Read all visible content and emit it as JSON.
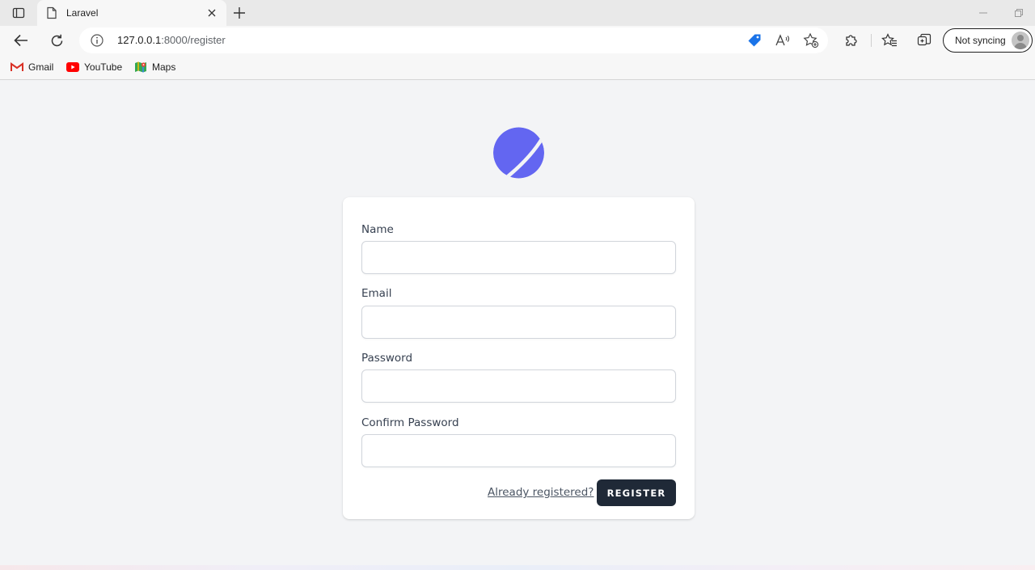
{
  "browser": {
    "tab": {
      "title": "Laravel",
      "favicon": "page-icon"
    },
    "address": {
      "host": "127.0.0.1",
      "path": ":8000/register"
    },
    "profile": {
      "label": "Not syncing"
    },
    "bookmarks": [
      {
        "label": "Gmail",
        "icon": "gmail-icon"
      },
      {
        "label": "YouTube",
        "icon": "youtube-icon"
      },
      {
        "label": "Maps",
        "icon": "maps-icon"
      }
    ]
  },
  "form": {
    "fields": [
      {
        "label": "Name",
        "value": ""
      },
      {
        "label": "Email",
        "value": ""
      },
      {
        "label": "Password",
        "value": ""
      },
      {
        "label": "Confirm Password",
        "value": ""
      }
    ],
    "login_link": "Already registered?",
    "submit_label": "REGISTER"
  },
  "colors": {
    "accent": "#6366f1",
    "button": "#1f2937",
    "page_bg": "#f3f4f6"
  }
}
